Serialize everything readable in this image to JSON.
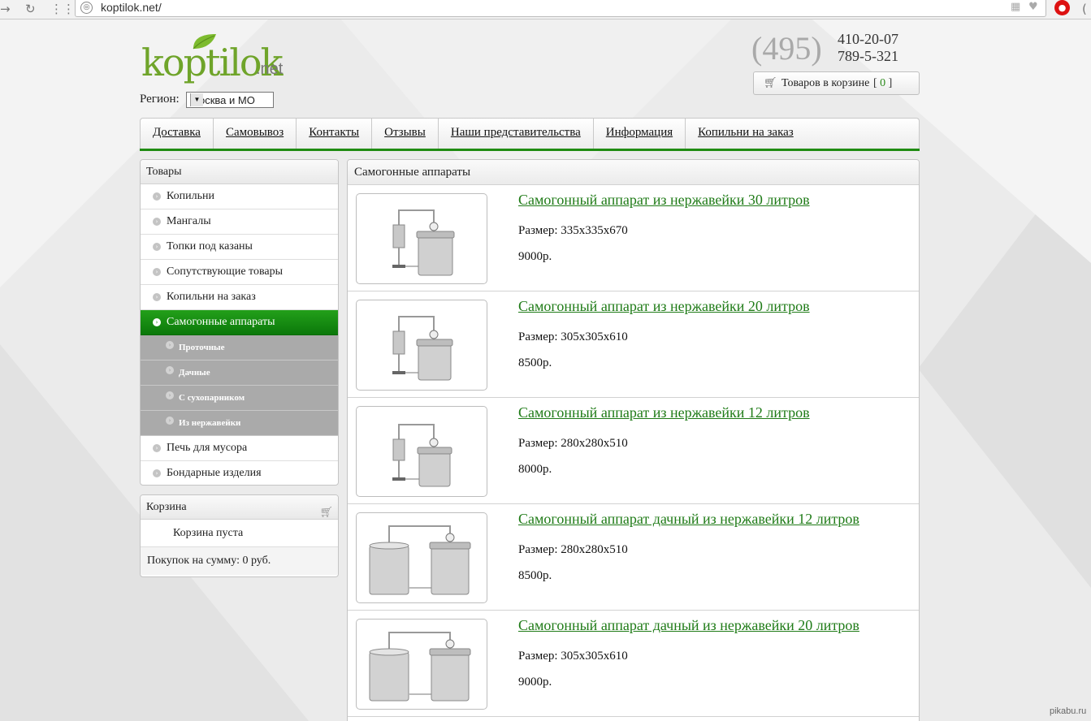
{
  "browser": {
    "url": "koptilok.net/",
    "site_icon": "globe-icon"
  },
  "header": {
    "logo_text": "koptilok",
    "logo_suffix": ".net",
    "region_label": "Регион:",
    "region_value": "Москва и МО",
    "phone_code": "(495)",
    "phone1": "410-20-07",
    "phone2": "789-5-321",
    "cart_label": "Товаров в корзине",
    "cart_count": "0"
  },
  "nav": {
    "items": [
      {
        "label": "Доставка"
      },
      {
        "label": "Самовывоз"
      },
      {
        "label": "Контакты"
      },
      {
        "label": "Отзывы"
      },
      {
        "label": "Наши представительства"
      },
      {
        "label": "Информация"
      },
      {
        "label": "Копильни на заказ"
      }
    ]
  },
  "sidebar": {
    "title": "Товары",
    "items": [
      {
        "label": "Копильни"
      },
      {
        "label": "Мангалы"
      },
      {
        "label": "Топки под казаны"
      },
      {
        "label": "Сопутствующие товары"
      },
      {
        "label": "Копильни на заказ"
      },
      {
        "label": "Самогонные аппараты",
        "active": true
      },
      {
        "label": "Проточные",
        "sub": true
      },
      {
        "label": "Дачные",
        "sub": true
      },
      {
        "label": "С сухопарником",
        "sub": true
      },
      {
        "label": "Из нержавейки",
        "sub": true
      },
      {
        "label": "Печь для мусора"
      },
      {
        "label": "Бондарные изделия"
      }
    ]
  },
  "cart_box": {
    "title": "Корзина",
    "empty_text": "Корзина пуста",
    "sum_text": "Покупок на сумму: 0 руб."
  },
  "content": {
    "title": "Самогонные аппараты",
    "products": [
      {
        "title": "Самогонный аппарат из нержавейки 30 литров",
        "size": "Размер: 335x335x670",
        "price": "9000р."
      },
      {
        "title": "Самогонный аппарат из нержавейки 20 литров",
        "size": "Размер: 305x305x610",
        "price": "8500р."
      },
      {
        "title": "Самогонный аппарат из нержавейки 12 литров",
        "size": "Размер: 280x280x510",
        "price": "8000р."
      },
      {
        "title": "Самогонный аппарат дачный из нержавейки 12 литров",
        "size": "Размер: 280x280x510",
        "price": "8500р."
      },
      {
        "title": "Самогонный аппарат дачный из нержавейки 20 литров",
        "size": "Размер: 305x305x610",
        "price": "9000р."
      }
    ]
  },
  "watermark": "pikabu.ru",
  "colors": {
    "brand_green": "#6fa42a",
    "link_green": "#1f7b17",
    "active_green": "#129012"
  }
}
